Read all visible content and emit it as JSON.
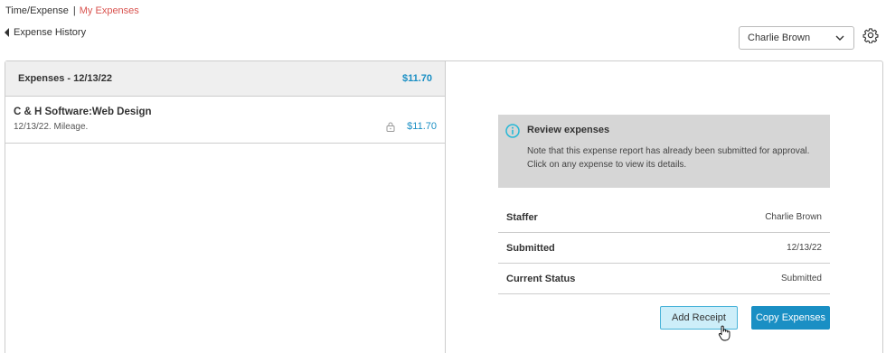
{
  "breadcrumb": {
    "root": "Time/Expense",
    "separator": "|",
    "current": "My Expenses"
  },
  "back_link": {
    "label": "Expense History",
    "icon": "caret-left-icon"
  },
  "staffer_select": {
    "value": "Charlie Brown",
    "icon": "chevron-down-icon"
  },
  "settings": {
    "icon": "gear-icon"
  },
  "expense_list": {
    "header_title": "Expenses - 12/13/22",
    "header_total": "$11.70",
    "items": [
      {
        "name": "C & H Software:Web Design",
        "description": "12/13/22. Mileage.",
        "amount": "$11.70",
        "locked": true
      }
    ]
  },
  "review": {
    "heading": "Review expenses",
    "text": "Note that this expense report has already been submitted for approval. Click on any expense to view its details.",
    "icon": "info-icon"
  },
  "details": [
    {
      "label": "Staffer",
      "value": "Charlie Brown"
    },
    {
      "label": "Submitted",
      "value": "12/13/22"
    },
    {
      "label": "Current Status",
      "value": "Submitted"
    }
  ],
  "buttons": {
    "add_receipt": "Add Receipt",
    "copy_expenses": "Copy Expenses"
  },
  "colors": {
    "accent": "#1a8fc4",
    "breadcrumb_current": "#d9534f",
    "info_bg": "#d6d6d6",
    "info_icon": "#27b8d6"
  }
}
